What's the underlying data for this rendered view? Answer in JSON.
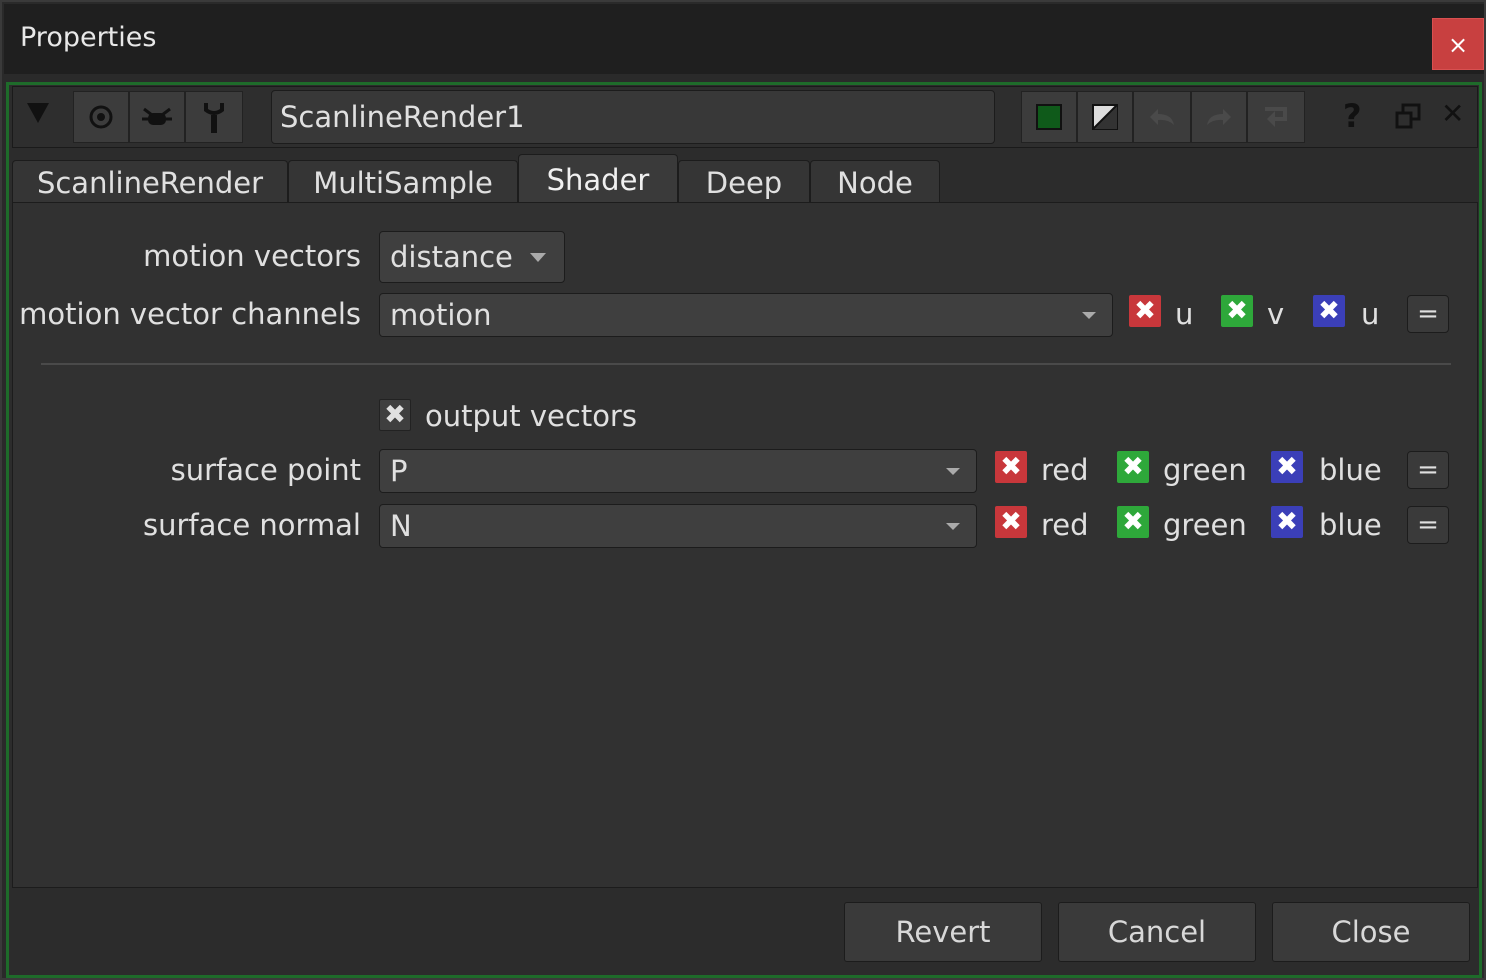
{
  "window": {
    "title": "Properties",
    "close_glyph": "×"
  },
  "toolbar": {
    "collapse_icon": "triangle-down-icon",
    "node_name": "ScanlineRender1",
    "help_glyph": "?",
    "close_glyph": "✕"
  },
  "tabs": [
    {
      "label": "ScanlineRender",
      "active": false
    },
    {
      "label": "MultiSample",
      "active": false
    },
    {
      "label": "Shader",
      "active": true
    },
    {
      "label": "Deep",
      "active": false
    },
    {
      "label": "Node",
      "active": false
    }
  ],
  "shader": {
    "motion_vectors": {
      "label": "motion vectors",
      "value": "distance"
    },
    "motion_vector_channels": {
      "label": "motion vector channels",
      "value": "motion",
      "channels": [
        "u",
        "v",
        "u"
      ],
      "eq": "="
    },
    "output_vectors": {
      "label": "output vectors",
      "checked": true
    },
    "surface_point": {
      "label": "surface point",
      "value": "P",
      "channels": [
        "red",
        "green",
        "blue"
      ],
      "eq": "="
    },
    "surface_normal": {
      "label": "surface normal",
      "value": "N",
      "channels": [
        "red",
        "green",
        "blue"
      ],
      "eq": "="
    }
  },
  "footer": {
    "revert": "Revert",
    "cancel": "Cancel",
    "close": "Close"
  },
  "colors": {
    "red": "#c8373b",
    "green": "#2ea83a",
    "blue": "#3b3fb8",
    "frame_green": "#1e6b2a"
  }
}
